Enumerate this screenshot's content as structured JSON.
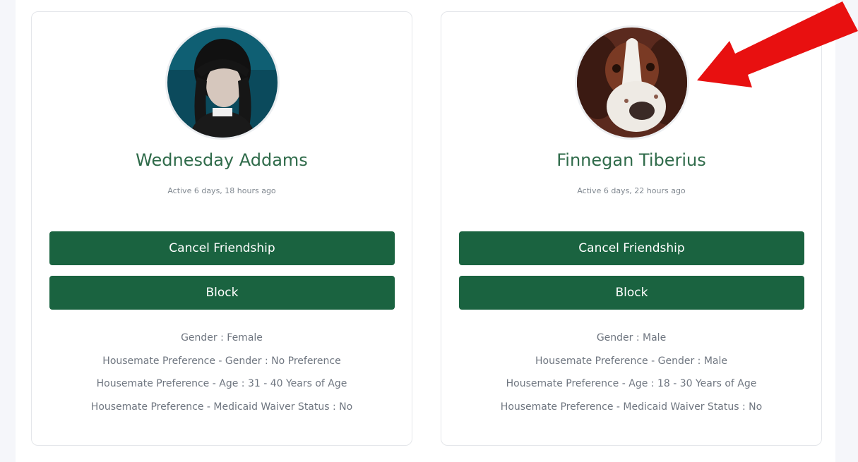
{
  "members": [
    {
      "name": "Wednesday Addams",
      "last_active": "Active 6 days, 18 hours ago",
      "cancel_label": "Cancel Friendship",
      "block_label": "Block",
      "details": [
        "Gender : Female",
        "Housemate Preference - Gender : No Preference",
        "Housemate Preference - Age : 31 - 40 Years of Age",
        "Housemate Preference - Medicaid Waiver Status : No"
      ]
    },
    {
      "name": "Finnegan Tiberius",
      "last_active": "Active 6 days, 22 hours ago",
      "cancel_label": "Cancel Friendship",
      "block_label": "Block",
      "details": [
        "Gender : Male",
        "Housemate Preference - Gender : Male",
        "Housemate Preference - Age : 18 - 30 Years of Age",
        "Housemate Preference - Medicaid Waiver Status : No"
      ]
    }
  ],
  "colors": {
    "accent": "#1a6340",
    "name_text": "#2f6b4a",
    "annotation_arrow": "#e81010"
  },
  "icons": {
    "annotation": "red-arrow-icon"
  }
}
